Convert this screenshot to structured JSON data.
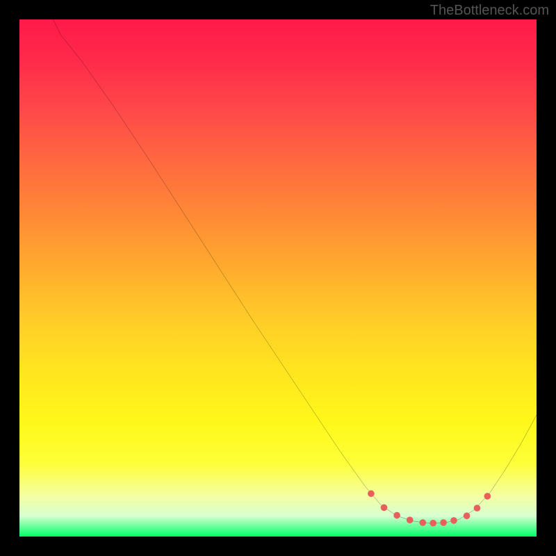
{
  "watermark": "TheBottleneck.com",
  "chart_data": {
    "type": "line",
    "title": "",
    "xlabel": "",
    "ylabel": "",
    "x_range": [
      0,
      100
    ],
    "y_range": [
      0,
      100
    ],
    "curve": [
      {
        "x": 6.5,
        "y": 100
      },
      {
        "x": 8,
        "y": 97
      },
      {
        "x": 12,
        "y": 92
      },
      {
        "x": 18,
        "y": 83.5
      },
      {
        "x": 25,
        "y": 73
      },
      {
        "x": 35,
        "y": 57.5
      },
      {
        "x": 45,
        "y": 42
      },
      {
        "x": 55,
        "y": 27
      },
      {
        "x": 62,
        "y": 16.5
      },
      {
        "x": 67,
        "y": 9.5
      },
      {
        "x": 70,
        "y": 6
      },
      {
        "x": 73,
        "y": 4
      },
      {
        "x": 76,
        "y": 3
      },
      {
        "x": 79,
        "y": 2.6
      },
      {
        "x": 82,
        "y": 2.6
      },
      {
        "x": 85,
        "y": 3.3
      },
      {
        "x": 88,
        "y": 5.2
      },
      {
        "x": 91,
        "y": 8.5
      },
      {
        "x": 94,
        "y": 13
      },
      {
        "x": 97,
        "y": 18
      },
      {
        "x": 100,
        "y": 23.5
      }
    ],
    "markers": [
      {
        "x": 68,
        "y": 8.3
      },
      {
        "x": 70.5,
        "y": 5.6
      },
      {
        "x": 73,
        "y": 4.1
      },
      {
        "x": 75.5,
        "y": 3.2
      },
      {
        "x": 78,
        "y": 2.7
      },
      {
        "x": 80,
        "y": 2.6
      },
      {
        "x": 82,
        "y": 2.7
      },
      {
        "x": 84,
        "y": 3.1
      },
      {
        "x": 86.5,
        "y": 4.0
      },
      {
        "x": 88.5,
        "y": 5.5
      },
      {
        "x": 90.5,
        "y": 7.8
      }
    ],
    "gradient_stops": [
      {
        "pos": 0,
        "color": "#ff1a4a"
      },
      {
        "pos": 8,
        "color": "#ff2a4a"
      },
      {
        "pos": 18,
        "color": "#ff4a49"
      },
      {
        "pos": 28,
        "color": "#ff6a3f"
      },
      {
        "pos": 38,
        "color": "#ff8a35"
      },
      {
        "pos": 48,
        "color": "#ffab2e"
      },
      {
        "pos": 58,
        "color": "#ffcc28"
      },
      {
        "pos": 68,
        "color": "#ffe51f"
      },
      {
        "pos": 78,
        "color": "#fff81a"
      },
      {
        "pos": 86,
        "color": "#fdff3a"
      },
      {
        "pos": 92,
        "color": "#f5ffa0"
      },
      {
        "pos": 96,
        "color": "#d8ffd0"
      },
      {
        "pos": 100,
        "color": "#00ff6a"
      }
    ],
    "marker_color": "#e8605c",
    "curve_color": "#000000"
  }
}
